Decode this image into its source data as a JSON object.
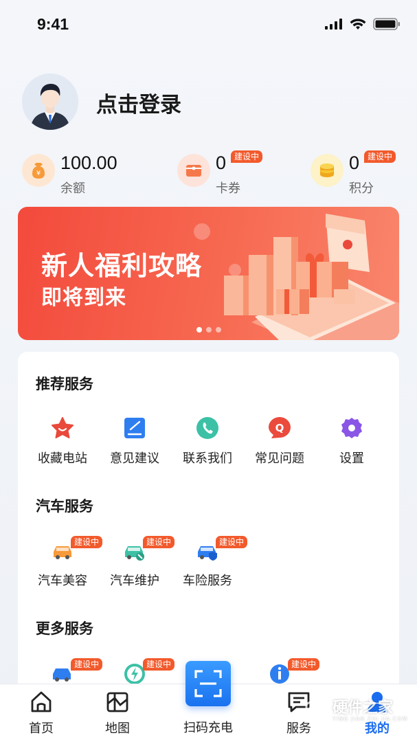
{
  "status_bar": {
    "time": "9:41"
  },
  "profile": {
    "login_label": "点击登录"
  },
  "stats": [
    {
      "value": "100.00",
      "label": "余额",
      "icon": "money-bag-icon",
      "color": "#f79a3a"
    },
    {
      "value": "0",
      "label": "卡券",
      "icon": "coupon-icon",
      "color": "#f6784a",
      "badge": "建设中"
    },
    {
      "value": "0",
      "label": "积分",
      "icon": "coins-icon",
      "color": "#f5c02e",
      "badge": "建设中"
    }
  ],
  "banner": {
    "title": "新人福利攻略",
    "subtitle": "即将到来",
    "slide_count": 3,
    "active_slide": 1
  },
  "sections": {
    "recommended": {
      "title": "推荐服务",
      "items": [
        {
          "label": "收藏电站",
          "icon": "star-icon",
          "color": "#e9493b"
        },
        {
          "label": "意见建议",
          "icon": "feedback-icon",
          "color": "#2f7ef0"
        },
        {
          "label": "联系我们",
          "icon": "phone-icon",
          "color": "#3cc1a6"
        },
        {
          "label": "常见问题",
          "icon": "question-icon",
          "color": "#ea4b3c"
        },
        {
          "label": "设置",
          "icon": "gear-icon",
          "color": "#8a56e6"
        }
      ]
    },
    "car": {
      "title": "汽车服务",
      "items": [
        {
          "label": "汽车美容",
          "icon": "car-wash-icon",
          "badge": "建设中"
        },
        {
          "label": "汽车维护",
          "icon": "car-repair-icon",
          "badge": "建设中"
        },
        {
          "label": "车险服务",
          "icon": "car-insurance-icon",
          "badge": "建设中"
        }
      ]
    },
    "more": {
      "title": "更多服务",
      "badges": [
        "建设中",
        "建设中",
        "建设中"
      ]
    }
  },
  "tabbar": {
    "tabs": [
      {
        "label": "首页",
        "icon": "home-icon"
      },
      {
        "label": "地图",
        "icon": "map-icon"
      },
      {
        "label": "服务",
        "icon": "service-chat-icon"
      },
      {
        "label": "我的",
        "icon": "profile-icon",
        "active": true
      }
    ],
    "scan_label": "扫码充电",
    "active_color": "#1a6cf0"
  },
  "watermark": {
    "text": "硬件之家",
    "sub": "YING JIAN ZHI JIA.COM"
  }
}
